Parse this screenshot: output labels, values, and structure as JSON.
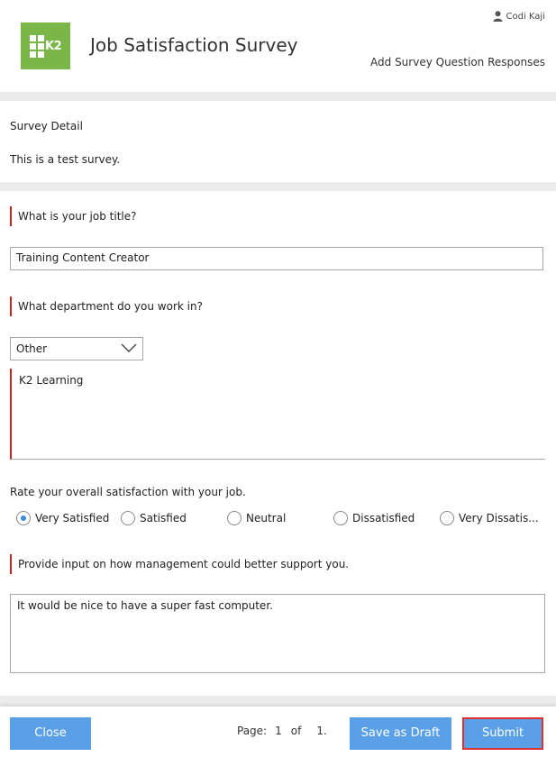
{
  "header": {
    "title": "Job Satisfaction Survey",
    "user_name": "Codi Kaji",
    "subtitle": "Add Survey Question Responses",
    "logo_text": "K2"
  },
  "survey_detail": {
    "heading": "Survey Detail",
    "description": "This is a test survey."
  },
  "questions": {
    "job_title": {
      "label": "What is your job title?",
      "value": "Training Content Creator"
    },
    "department": {
      "label": "What department do you work in?",
      "selected": "Other",
      "other_value": "K2 Learning"
    },
    "satisfaction": {
      "label": "Rate your overall satisfaction with your job.",
      "options": [
        "Very Satisfied",
        "Satisfied",
        "Neutral",
        "Dissatisfied",
        "Very Dissatis..."
      ],
      "selected_index": 0
    },
    "management": {
      "label": "Provide input on how management could better support you.",
      "value": "It would be nice to have a super fast computer."
    }
  },
  "footer": {
    "close_label": "Close",
    "page_label": "Page:",
    "page_current": "1",
    "page_of": "of",
    "page_total": "1.",
    "save_draft_label": "Save as Draft",
    "submit_label": "Submit"
  },
  "colors": {
    "accent_green": "#7ab648",
    "button_blue": "#5aa0e8",
    "required_red": "#cc2222",
    "submit_outline": "#e03030"
  }
}
